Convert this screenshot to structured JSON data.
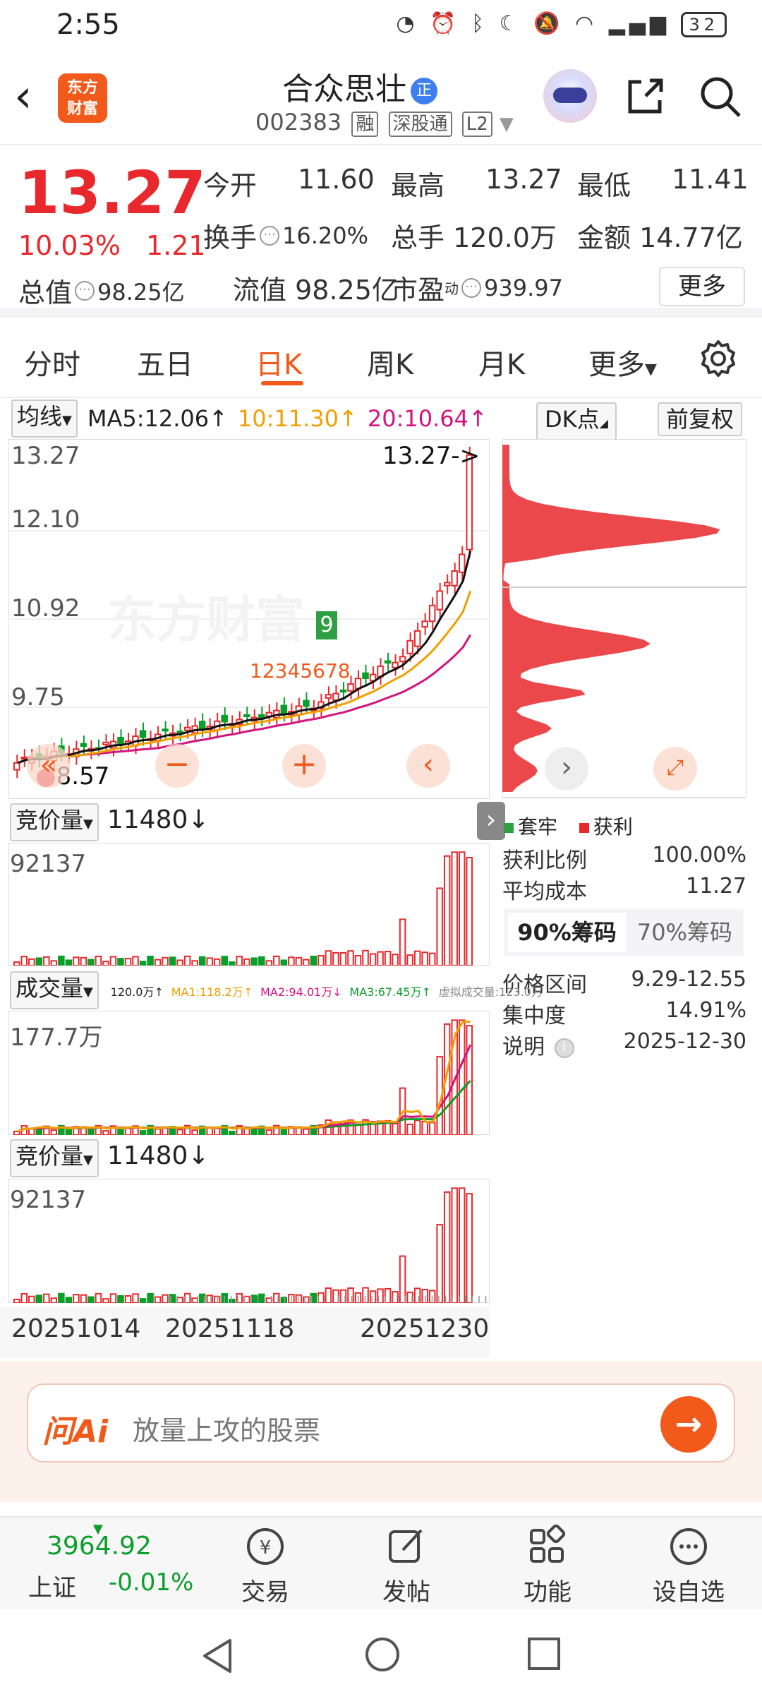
{
  "status": {
    "time": "2:55",
    "battery": "32",
    "signal": "4G"
  },
  "header": {
    "name": "合众思壮",
    "name_badge": "正",
    "code": "002383",
    "tags": [
      "融",
      "深股通",
      "L2"
    ],
    "logo_text_1": "东方",
    "logo_text_2": "财富"
  },
  "quote": {
    "price": "13.27",
    "pct": "10.03%",
    "chg": "1.21",
    "open_label": "今开",
    "open": "11.60",
    "high_label": "最高",
    "high": "13.27",
    "low_label": "最低",
    "low": "11.41",
    "turnover_label": "换手",
    "turnover": "16.20%",
    "vol_label": "总手",
    "vol": "120.0万",
    "amount_label": "金额",
    "amount": "14.77亿",
    "total_cap_label": "总值",
    "total_cap": "98.25亿",
    "float_cap_label": "流值",
    "float_cap": "98.25亿",
    "pe_label": "市盈",
    "pe_sup": "动",
    "pe": "939.97",
    "more": "更多"
  },
  "tabs": [
    "分时",
    "五日",
    "日K",
    "周K",
    "月K",
    "更多"
  ],
  "active_tab": "日K",
  "ma": {
    "selector": "均线",
    "ma5": "MA5:12.06↑",
    "ma10": "10:11.30↑",
    "ma20": "20:10.64↑",
    "dk": "DK点",
    "adjust": "前复权"
  },
  "kline": {
    "labels": [
      "13.27",
      "12.10",
      "10.92",
      "9.75",
      "8.57"
    ],
    "last_arrow": "13.27->",
    "low_marker": "8.57",
    "marker_9": "9",
    "markers": [
      "1",
      "2",
      "3",
      "4",
      "5",
      "6",
      "7",
      "8"
    ]
  },
  "sub1": {
    "selector": "竞价量",
    "value": "11480↓",
    "max": "92137"
  },
  "sub2": {
    "selector": "成交量",
    "legend": [
      "120.0万↑",
      "MA1:118.2万↑",
      "MA2:94.01万↓",
      "MA3:67.45万↑",
      "虚拟成交量:123.0万"
    ],
    "max": "177.7万"
  },
  "sub3": {
    "selector": "竞价量",
    "value": "11480↓",
    "max": "92137"
  },
  "dates": [
    "20251014",
    "20251118",
    "20251230"
  ],
  "chips": {
    "legend_trapped": "套牢",
    "legend_profit": "获利",
    "profit_ratio_label": "获利比例",
    "profit_ratio": "100.00%",
    "avg_cost_label": "平均成本",
    "avg_cost": "11.27",
    "tab_90": "90%筹码",
    "tab_70": "70%筹码",
    "range_label": "价格区间",
    "range": "9.29-12.55",
    "concentration_label": "集中度",
    "concentration": "14.91%",
    "note_label": "说明",
    "note": "2025-12-30"
  },
  "ask": {
    "brand": "问Ai",
    "placeholder": "放量上攻的股票"
  },
  "bottom": {
    "index_value": "3964.92",
    "index_name": "上证",
    "index_chg": "-0.01%",
    "nav": [
      "交易",
      "发帖",
      "功能",
      "设自选"
    ]
  }
}
